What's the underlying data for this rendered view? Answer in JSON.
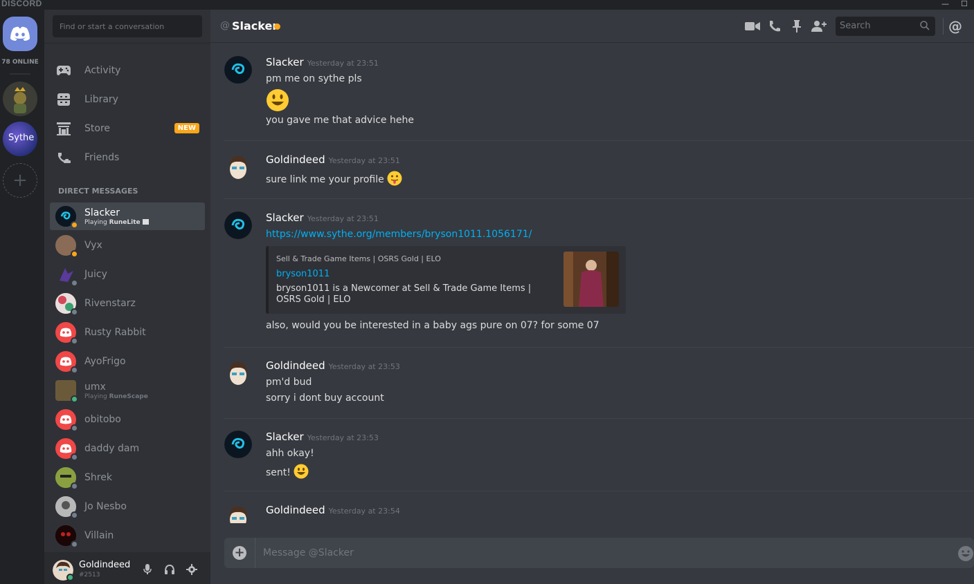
{
  "window": {
    "brand": "DISCORD",
    "minimize": "—",
    "maximize": "☐"
  },
  "guilds": {
    "online_label": "78 ONLINE",
    "sythe_label": "Sythe",
    "add_label": "+"
  },
  "sidebar": {
    "search_placeholder": "Find or start a conversation",
    "nav": [
      {
        "label": "Activity",
        "icon": "gamepad-icon"
      },
      {
        "label": "Library",
        "icon": "library-icon"
      },
      {
        "label": "Store",
        "icon": "store-icon",
        "badge": "NEW"
      },
      {
        "label": "Friends",
        "icon": "friends-icon"
      }
    ],
    "dm_header": "DIRECT MESSAGES",
    "dms": [
      {
        "name": "Slacker",
        "sub_prefix": "Playing ",
        "sub_game": "RuneLite",
        "status": "#faa61a",
        "active": true
      },
      {
        "name": "Vyx",
        "status": "#faa61a"
      },
      {
        "name": "Juicy",
        "status": "#747f8d"
      },
      {
        "name": "Rivenstarz",
        "status": "#747f8d"
      },
      {
        "name": "Rusty Rabbit",
        "status": "#747f8d"
      },
      {
        "name": "AyoFrigo",
        "status": "#747f8d"
      },
      {
        "name": "umx",
        "sub_prefix": "Playing ",
        "sub_game": "RuneScape",
        "status": "#43b581"
      },
      {
        "name": "obitobo",
        "status": "#747f8d"
      },
      {
        "name": "daddy dam",
        "status": "#747f8d"
      },
      {
        "name": "Shrek",
        "status": "#747f8d"
      },
      {
        "name": "Jo Nesbo",
        "status": "#747f8d"
      },
      {
        "name": "Villain",
        "status": "#747f8d"
      }
    ],
    "user": {
      "name": "Goldindeed",
      "tag": "#2513",
      "status": "#43b581"
    }
  },
  "header": {
    "at": "@",
    "title": "Slacker",
    "search_placeholder": "Search",
    "mention_label": "@"
  },
  "messages": [
    {
      "author": "Slacker",
      "time": "Yesterday at 23:51",
      "lines": [
        "pm me on sythe pls",
        "you gave me that advice hehe"
      ]
    },
    {
      "author": "Goldindeed",
      "time": "Yesterday at 23:51",
      "lines": [
        "sure link me your profile"
      ]
    },
    {
      "author": "Slacker",
      "time": "Yesterday at 23:51",
      "link": "https://www.sythe.org/members/bryson1011.1056171/",
      "embed": {
        "provider": "Sell & Trade Game Items | OSRS Gold | ELO",
        "title": "bryson1011",
        "description": "bryson1011 is a Newcomer at Sell & Trade Game Items | OSRS Gold | ELO"
      },
      "lines": [
        "also, would you be interested in a baby ags pure on 07? for some 07"
      ]
    },
    {
      "author": "Goldindeed",
      "time": "Yesterday at 23:53",
      "lines": [
        "pm'd bud",
        "sorry i dont buy account"
      ]
    },
    {
      "author": "Slacker",
      "time": "Yesterday at 23:53",
      "lines": [
        "ahh okay!",
        "sent!"
      ]
    },
    {
      "author": "Goldindeed",
      "time": "Yesterday at 23:54",
      "lines": []
    }
  ],
  "composer": {
    "placeholder": "Message @Slacker"
  },
  "colors": {
    "accent": "#7289da",
    "link": "#00b0f4",
    "idle": "#faa61a",
    "online": "#43b581",
    "offline": "#747f8d"
  }
}
